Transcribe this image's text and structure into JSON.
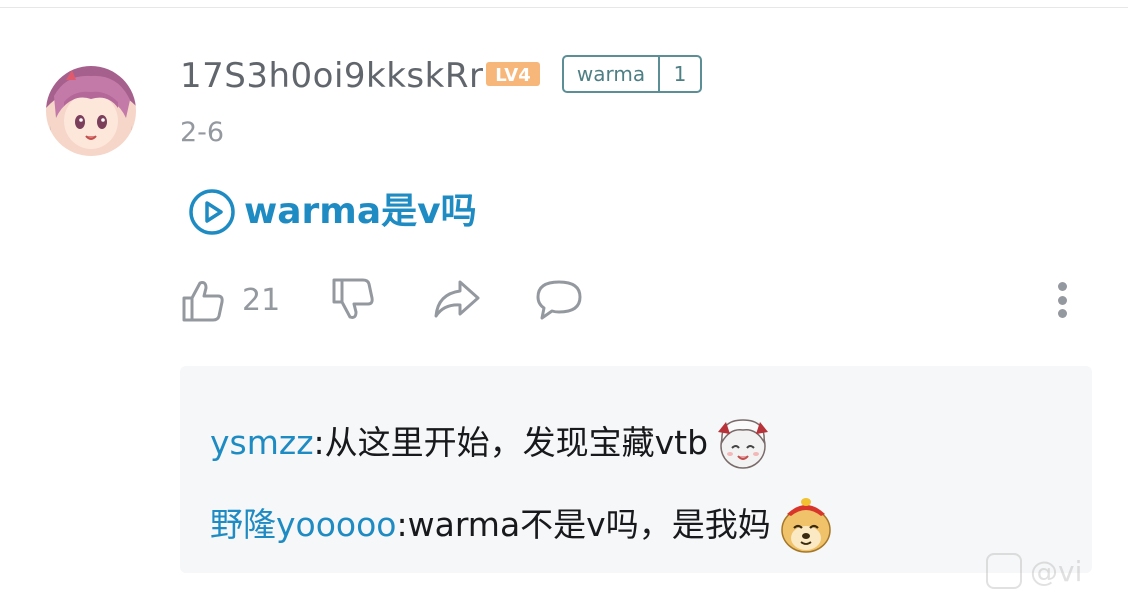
{
  "comment": {
    "username": "17S3h0oi9kkskRr",
    "level_badge": "LV4",
    "fan_badge": {
      "name": "warma",
      "level": "1"
    },
    "date": "2-6",
    "video_link_text": "warma是v吗",
    "actions": {
      "like_count": "21",
      "icons": [
        "thumbs-up-icon",
        "thumbs-down-icon",
        "share-icon",
        "reply-icon",
        "more-icon"
      ]
    }
  },
  "replies": [
    {
      "user": "ysmzz",
      "separator": ":",
      "text": " 从这里开始，发现宝藏vtb",
      "emote": "anime-girl-emote"
    },
    {
      "user": "野隆yooooo",
      "separator": ":",
      "text": " warma不是v吗，是我妈",
      "emote": "doge-emote"
    }
  ],
  "watermark": {
    "text": "@vi"
  },
  "colors": {
    "link_blue": "#1e8bc3",
    "text_gray": "#61666d",
    "meta_gray": "#9499a0",
    "badge_teal": "#5b8f95",
    "level_orange": "#f8b77a",
    "panel_bg": "#f6f7f8"
  }
}
